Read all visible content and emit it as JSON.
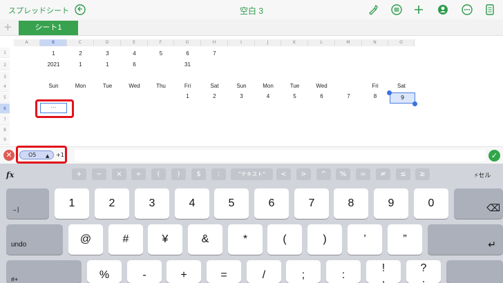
{
  "topbar": {
    "back_label": "スプレッドシート",
    "title": "空白 3",
    "icons": [
      "undo-icon",
      "format-brush-icon",
      "list-icon",
      "plus-icon",
      "collaborate-icon",
      "more-icon",
      "document-icon"
    ]
  },
  "tabs": {
    "add_label": "+",
    "sheet1": "シート1"
  },
  "sheet": {
    "columns": [
      "A",
      "B",
      "C",
      "D",
      "E",
      "F",
      "G",
      "H",
      "I",
      "J",
      "K",
      "L",
      "M",
      "N",
      "O"
    ],
    "rows": [
      "1",
      "2",
      "3",
      "4",
      "5",
      "6",
      "7",
      "8",
      "9"
    ],
    "row1": [
      "1",
      "2",
      "3",
      "4",
      "5",
      "6",
      "7"
    ],
    "row2": [
      "2021",
      "1",
      "1",
      "6",
      "31"
    ],
    "row4": [
      "Sun",
      "Mon",
      "Tue",
      "Wed",
      "Thu",
      "Fri",
      "Sat",
      "Sun",
      "Mon",
      "Tue",
      "Wed",
      "Fri",
      "Sat"
    ],
    "row5": [
      "1",
      "2",
      "3",
      "4",
      "5",
      "6",
      "7",
      "8",
      "9"
    ],
    "selected_value": "9",
    "edit_cell_text": "⋯"
  },
  "formula": {
    "cancel_label": "✕",
    "ref_label": "O5",
    "ref_arrow": "▲",
    "ref_extra": "+1",
    "accept_label": "✓"
  },
  "keyboard": {
    "fx_label": "fx",
    "ops": [
      "+",
      "−",
      "×",
      "÷",
      "(",
      ")",
      "$",
      ":",
      "\"テキスト\"",
      "<",
      ">",
      "^",
      "%",
      "=",
      "≠",
      "≤",
      "≥"
    ],
    "cell_label": "セル",
    "row1": [
      "1",
      "2",
      "3",
      "4",
      "5",
      "6",
      "7",
      "8",
      "9",
      "0"
    ],
    "tab_label": "→|",
    "delete_label": "⌫",
    "undo_label": "undo",
    "row2": [
      "@",
      "#",
      "¥",
      "&",
      "*",
      "(",
      ")",
      "’",
      "”"
    ],
    "return_label": "↵",
    "row3": [
      "%",
      "-",
      "+",
      "=",
      "/",
      ";",
      ":",
      "!",
      "?"
    ],
    "shift_label": "#+",
    "comma_label": ",",
    "period_label": "."
  }
}
